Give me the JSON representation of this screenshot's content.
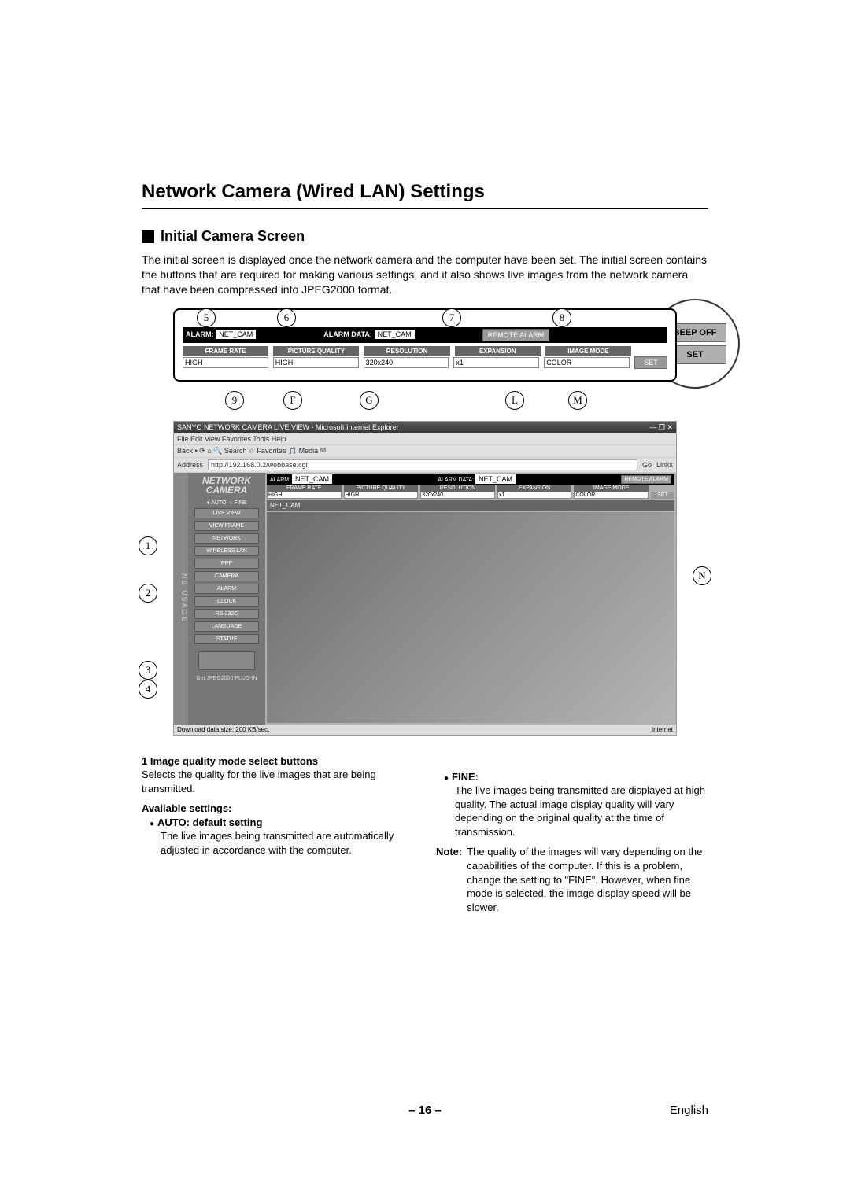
{
  "title": "Network Camera (Wired LAN) Settings",
  "section_heading": "Initial Camera Screen",
  "intro": "The initial screen is displayed once the network camera and the computer have been set. The initial screen contains the buttons that are required for making various settings, and it also shows live images from the network camera that have been compressed into JPEG2000 format.",
  "zoom": {
    "beep_off": "BEEP OFF",
    "set": "SET"
  },
  "strip": {
    "alarm_label": "ALARM:",
    "alarm_value": "NET_CAM",
    "alarm_data_label": "ALARM DATA:",
    "alarm_data_value": "NET_CAM",
    "remote_alarm": "REMOTE ALARM",
    "headers": {
      "frame_rate": "FRAME RATE",
      "picture_quality": "PICTURE QUALITY",
      "resolution": "RESOLUTION",
      "expansion": "EXPANSION",
      "image_mode": "IMAGE MODE"
    },
    "values": {
      "frame_rate": "HIGH",
      "picture_quality": "HIGH",
      "resolution": "320x240",
      "expansion": "x1",
      "image_mode": "COLOR"
    },
    "set": "SET"
  },
  "callouts": {
    "c1": "1",
    "c2": "2",
    "c3": "3",
    "c4": "4",
    "c5": "5",
    "c6": "6",
    "c7": "7",
    "c8": "8",
    "c9": "9",
    "c10": "F",
    "c11": "G",
    "c12": "L",
    "c13": "M",
    "c14": "N"
  },
  "browser": {
    "title": "SANYO NETWORK CAMERA LIVE VIEW - Microsoft Internet Explorer",
    "menu": "File   Edit   View   Favorites   Tools   Help",
    "toolbar": "Back  •    ⟳   ⌂   🔍 Search   ☆ Favorites   🎵 Media   ✉",
    "addr_label": "Address",
    "addr_value": "http://192.168.0.2/webbase.cgi",
    "go": "Go",
    "links": "Links",
    "usage_strip": "NE   USAGE",
    "logo_line1": "NETWORK",
    "logo_line2": "CAMERA",
    "mode_auto": "● AUTO",
    "mode_fine": "○ FINE",
    "side_buttons": [
      "LIVE VIEW",
      "VIEW FRAME",
      "NETWORK",
      "WIRELESS LAN",
      "PPP",
      "CAMERA",
      "ALARM",
      "CLOCK",
      "RS-232C",
      "LANGUAGE",
      "STATUS"
    ],
    "plugin": "Get JPEG2000 PLUG-IN",
    "netcam_bar": "NET_CAM",
    "status_left": "Download data size: 200 KB/sec.",
    "status_right": "Internet"
  },
  "body": {
    "item1_head": "1 Image quality mode select buttons",
    "item1_text": "Selects the quality for the live images that are being transmitted.",
    "avail_head": "Available settings:",
    "auto_head": "AUTO: default setting",
    "auto_text": "The live images being transmitted are automatically adjusted in accordance with the computer.",
    "fine_head": "FINE:",
    "fine_text": "The live images being transmitted are displayed at high quality. The actual image display quality will vary depending on the original quality at the time of transmission.",
    "note_label": "Note:",
    "note_text": "The quality of the images will vary depending on the capabilities of the computer. If this is a problem, change the setting to \"FINE\". However, when fine mode is selected, the image display speed will be slower."
  },
  "footer": {
    "page": "– 16 –",
    "lang": "English"
  }
}
